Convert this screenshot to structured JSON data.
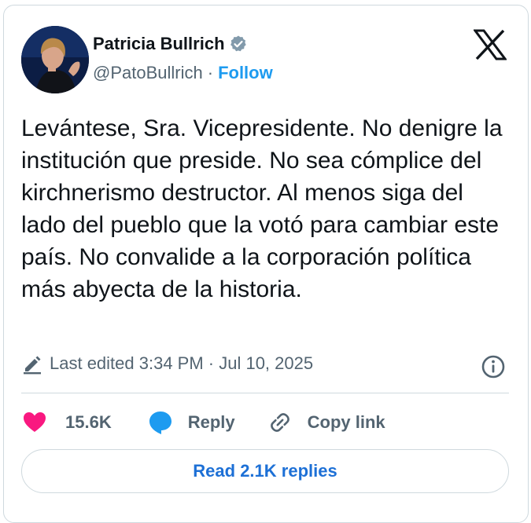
{
  "author": {
    "display_name": "Patricia Bullrich",
    "handle": "@PatoBullrich",
    "separator": "·",
    "follow_label": "Follow"
  },
  "tweet": {
    "text": "Levántese, Sra. Vicepresidente. No denigre la institución que preside. No sea cómplice del kirchnerismo destructor. Al menos siga del lado del pueblo que la votó para cambiar este país. No convalide a la corporación política más abyecta de la historia."
  },
  "meta": {
    "edited": "Last edited 3:34 PM · Jul 10, 2025"
  },
  "actions": {
    "likes": "15.6K",
    "reply_label": "Reply",
    "copy_link_label": "Copy link"
  },
  "read_replies_label": "Read 2.1K replies",
  "icons": {
    "verified": "verified-badge-icon",
    "brand": "x-logo-icon",
    "edit": "pencil-icon",
    "info": "info-icon",
    "like": "heart-icon",
    "reply": "speech-bubble-icon",
    "copy": "link-icon"
  },
  "colors": {
    "accent": "#1d9bf0",
    "like": "#f91880",
    "secondary_text": "#536471",
    "border": "#cfd9de"
  }
}
